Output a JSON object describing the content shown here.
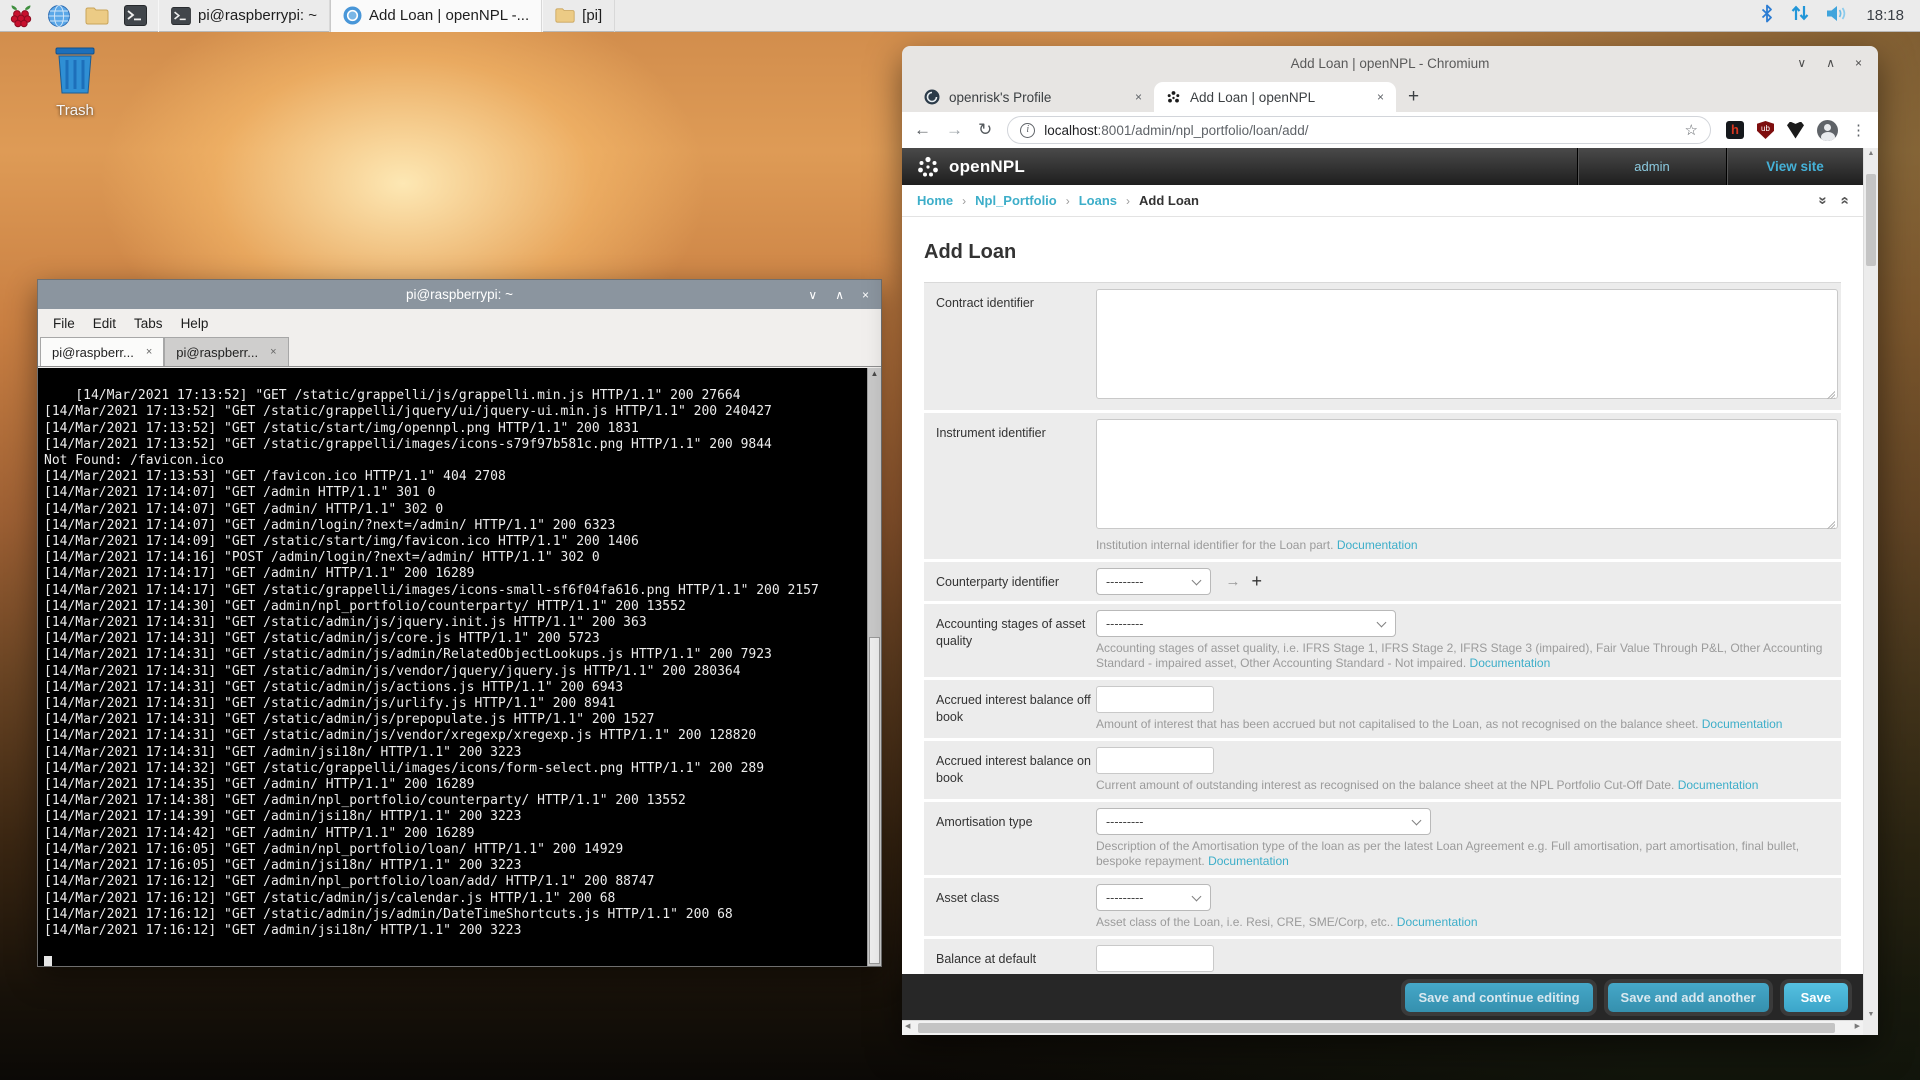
{
  "colors": {
    "accent": "#3daec9",
    "header_dark": "#272727",
    "terminal_bg": "#000000",
    "taskbar_bg": "#ebebeb"
  },
  "icons": {
    "window_minimize": "∨",
    "window_maximize": "∧",
    "window_close": "×",
    "tab_close": "×",
    "back": "←",
    "forward": "→",
    "reload": "↻",
    "info": "i",
    "star": "☆",
    "menu_dots": "⋮",
    "new_tab": "+",
    "goto_arrow": "→",
    "add_related": "+",
    "scroll_up": "▲",
    "scroll_down": "▼",
    "scroll_left": "◀",
    "scroll_right": "▶",
    "collapse_all": "»",
    "expand_all": "»",
    "breadcrumb_sep": "›"
  },
  "taskbar": {
    "windows": [
      {
        "label": "pi@raspberrypi: ~"
      },
      {
        "label": "Add Loan | openNPL -..."
      },
      {
        "label": "[pi]"
      }
    ],
    "clock": "18:18"
  },
  "desktop": {
    "trash_label": "Trash"
  },
  "terminal": {
    "title": "pi@raspberrypi: ~",
    "menu": [
      "File",
      "Edit",
      "Tabs",
      "Help"
    ],
    "tabs": [
      "pi@raspberr...",
      "pi@raspberr..."
    ],
    "lines": [
      "[14/Mar/2021 17:13:52] \"GET /static/grappelli/js/grappelli.min.js HTTP/1.1\" 200 27664",
      "[14/Mar/2021 17:13:52] \"GET /static/grappelli/jquery/ui/jquery-ui.min.js HTTP/1.1\" 200 240427",
      "[14/Mar/2021 17:13:52] \"GET /static/start/img/opennpl.png HTTP/1.1\" 200 1831",
      "[14/Mar/2021 17:13:52] \"GET /static/grappelli/images/icons-s79f97b581c.png HTTP/1.1\" 200 9844",
      "Not Found: /favicon.ico",
      "[14/Mar/2021 17:13:53] \"GET /favicon.ico HTTP/1.1\" 404 2708",
      "[14/Mar/2021 17:14:07] \"GET /admin HTTP/1.1\" 301 0",
      "[14/Mar/2021 17:14:07] \"GET /admin/ HTTP/1.1\" 302 0",
      "[14/Mar/2021 17:14:07] \"GET /admin/login/?next=/admin/ HTTP/1.1\" 200 6323",
      "[14/Mar/2021 17:14:09] \"GET /static/start/img/favicon.ico HTTP/1.1\" 200 1406",
      "[14/Mar/2021 17:14:16] \"POST /admin/login/?next=/admin/ HTTP/1.1\" 302 0",
      "[14/Mar/2021 17:14:17] \"GET /admin/ HTTP/1.1\" 200 16289",
      "[14/Mar/2021 17:14:17] \"GET /static/grappelli/images/icons-small-sf6f04fa616.png HTTP/1.1\" 200 2157",
      "[14/Mar/2021 17:14:30] \"GET /admin/npl_portfolio/counterparty/ HTTP/1.1\" 200 13552",
      "[14/Mar/2021 17:14:31] \"GET /static/admin/js/jquery.init.js HTTP/1.1\" 200 363",
      "[14/Mar/2021 17:14:31] \"GET /static/admin/js/core.js HTTP/1.1\" 200 5723",
      "[14/Mar/2021 17:14:31] \"GET /static/admin/js/admin/RelatedObjectLookups.js HTTP/1.1\" 200 7923",
      "[14/Mar/2021 17:14:31] \"GET /static/admin/js/vendor/jquery/jquery.js HTTP/1.1\" 200 280364",
      "[14/Mar/2021 17:14:31] \"GET /static/admin/js/actions.js HTTP/1.1\" 200 6943",
      "[14/Mar/2021 17:14:31] \"GET /static/admin/js/urlify.js HTTP/1.1\" 200 8941",
      "[14/Mar/2021 17:14:31] \"GET /static/admin/js/prepopulate.js HTTP/1.1\" 200 1527",
      "[14/Mar/2021 17:14:31] \"GET /static/admin/js/vendor/xregexp/xregexp.js HTTP/1.1\" 200 128820",
      "[14/Mar/2021 17:14:31] \"GET /admin/jsi18n/ HTTP/1.1\" 200 3223",
      "[14/Mar/2021 17:14:32] \"GET /static/grappelli/images/icons/form-select.png HTTP/1.1\" 200 289",
      "[14/Mar/2021 17:14:35] \"GET /admin/ HTTP/1.1\" 200 16289",
      "[14/Mar/2021 17:14:38] \"GET /admin/npl_portfolio/counterparty/ HTTP/1.1\" 200 13552",
      "[14/Mar/2021 17:14:39] \"GET /admin/jsi18n/ HTTP/1.1\" 200 3223",
      "[14/Mar/2021 17:14:42] \"GET /admin/ HTTP/1.1\" 200 16289",
      "[14/Mar/2021 17:16:05] \"GET /admin/npl_portfolio/loan/ HTTP/1.1\" 200 14929",
      "[14/Mar/2021 17:16:05] \"GET /admin/jsi18n/ HTTP/1.1\" 200 3223",
      "[14/Mar/2021 17:16:12] \"GET /admin/npl_portfolio/loan/add/ HTTP/1.1\" 200 88747",
      "[14/Mar/2021 17:16:12] \"GET /static/admin/js/calendar.js HTTP/1.1\" 200 68",
      "[14/Mar/2021 17:16:12] \"GET /static/admin/js/admin/DateTimeShortcuts.js HTTP/1.1\" 200 68",
      "[14/Mar/2021 17:16:12] \"GET /admin/jsi18n/ HTTP/1.1\" 200 3223"
    ]
  },
  "browser": {
    "window_title": "Add Loan | openNPL - Chromium",
    "tabs": [
      {
        "title": "openrisk's Profile"
      },
      {
        "title": "Add Loan | openNPL"
      }
    ],
    "url_host": "localhost",
    "url_rest": ":8001/admin/npl_portfolio/loan/add/"
  },
  "page": {
    "brand": "openNPL",
    "nav_admin": "admin",
    "nav_view_site": "View site",
    "breadcrumbs": [
      "Home",
      "Npl_Portfolio",
      "Loans"
    ],
    "breadcrumb_current": "Add Loan",
    "title": "Add Loan",
    "select_placeholder": "---------",
    "doc_link": "Documentation",
    "fields": {
      "contract": {
        "label": "Contract identifier"
      },
      "instrument": {
        "label": "Instrument identifier",
        "help": "Institution internal identifier for the Loan part."
      },
      "counterparty": {
        "label": "Counterparty identifier"
      },
      "accounting": {
        "label": "Accounting stages of asset quality",
        "help": "Accounting stages of asset quality, i.e. IFRS Stage 1, IFRS Stage 2, IFRS Stage 3 (impaired), Fair Value Through P&L, Other Accounting Standard - impaired asset, Other Accounting Standard - Not impaired."
      },
      "accrued_off": {
        "label": "Accrued interest balance off book",
        "help": "Amount of interest that has been accrued but not capitalised to the Loan, as not recognised on the balance sheet."
      },
      "accrued_on": {
        "label": "Accrued interest balance on book",
        "help": "Current amount of outstanding interest as recognised on the balance sheet at the NPL Portfolio Cut-Off Date."
      },
      "amortisation": {
        "label": "Amortisation type",
        "help": "Description of the Amortisation type of the loan as per the latest Loan Agreement e.g. Full amortisation, part amortisation, final bullet, bespoke repayment."
      },
      "asset_class": {
        "label": "Asset class",
        "help": "Asset class of the Loan, i.e. Resi, CRE, SME/Corp, etc.."
      },
      "balance_default": {
        "label": "Balance at default"
      }
    },
    "buttons": {
      "save_continue": "Save and continue editing",
      "save_add": "Save and add another",
      "save": "Save"
    }
  }
}
